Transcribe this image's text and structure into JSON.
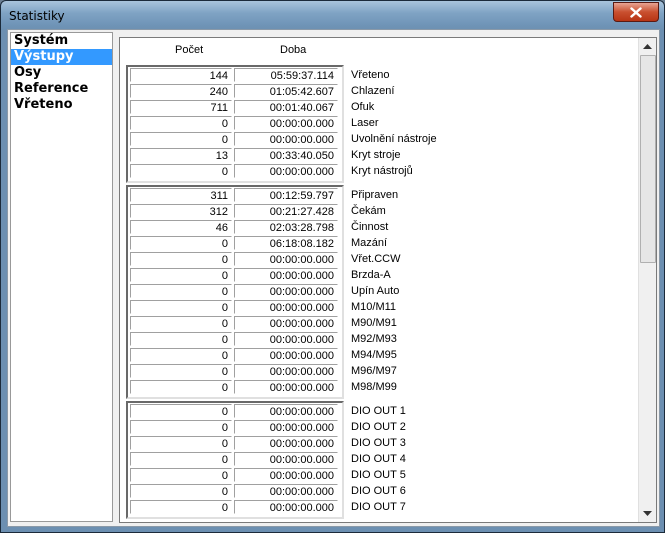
{
  "window": {
    "title": "Statistiky"
  },
  "nav": {
    "items": [
      "Systém",
      "Výstupy",
      "Osy",
      "Reference",
      "Vřeteno"
    ],
    "selected_index": 1
  },
  "table": {
    "count_header": "Počet",
    "time_header": "Doba",
    "groups": [
      {
        "rows": [
          {
            "count": "144",
            "time": "05:59:37.114",
            "label": "Vřeteno"
          },
          {
            "count": "240",
            "time": "01:05:42.607",
            "label": "Chlazení"
          },
          {
            "count": "711",
            "time": "00:01:40.067",
            "label": "Ofuk"
          },
          {
            "count": "0",
            "time": "00:00:00.000",
            "label": "Laser"
          },
          {
            "count": "0",
            "time": "00:00:00.000",
            "label": "Uvolnění nástroje"
          },
          {
            "count": "13",
            "time": "00:33:40.050",
            "label": "Kryt stroje"
          },
          {
            "count": "0",
            "time": "00:00:00.000",
            "label": "Kryt nástrojů"
          }
        ]
      },
      {
        "rows": [
          {
            "count": "311",
            "time": "00:12:59.797",
            "label": "Připraven"
          },
          {
            "count": "312",
            "time": "00:21:27.428",
            "label": "Čekám"
          },
          {
            "count": "46",
            "time": "02:03:28.798",
            "label": "Činnost"
          },
          {
            "count": "0",
            "time": "06:18:08.182",
            "label": "Mazání"
          },
          {
            "count": "0",
            "time": "00:00:00.000",
            "label": "Vřet.CCW"
          },
          {
            "count": "0",
            "time": "00:00:00.000",
            "label": "Brzda-A"
          },
          {
            "count": "0",
            "time": "00:00:00.000",
            "label": "Upín Auto"
          },
          {
            "count": "0",
            "time": "00:00:00.000",
            "label": "M10/M11"
          },
          {
            "count": "0",
            "time": "00:00:00.000",
            "label": "M90/M91"
          },
          {
            "count": "0",
            "time": "00:00:00.000",
            "label": "M92/M93"
          },
          {
            "count": "0",
            "time": "00:00:00.000",
            "label": "M94/M95"
          },
          {
            "count": "0",
            "time": "00:00:00.000",
            "label": "M96/M97"
          },
          {
            "count": "0",
            "time": "00:00:00.000",
            "label": "M98/M99"
          }
        ]
      },
      {
        "rows": [
          {
            "count": "0",
            "time": "00:00:00.000",
            "label": "DIO OUT 1"
          },
          {
            "count": "0",
            "time": "00:00:00.000",
            "label": "DIO OUT 2"
          },
          {
            "count": "0",
            "time": "00:00:00.000",
            "label": "DIO OUT 3"
          },
          {
            "count": "0",
            "time": "00:00:00.000",
            "label": "DIO OUT 4"
          },
          {
            "count": "0",
            "time": "00:00:00.000",
            "label": "DIO OUT 5"
          },
          {
            "count": "0",
            "time": "00:00:00.000",
            "label": "DIO OUT 6"
          },
          {
            "count": "0",
            "time": "00:00:00.000",
            "label": "DIO OUT 7"
          }
        ]
      }
    ]
  }
}
